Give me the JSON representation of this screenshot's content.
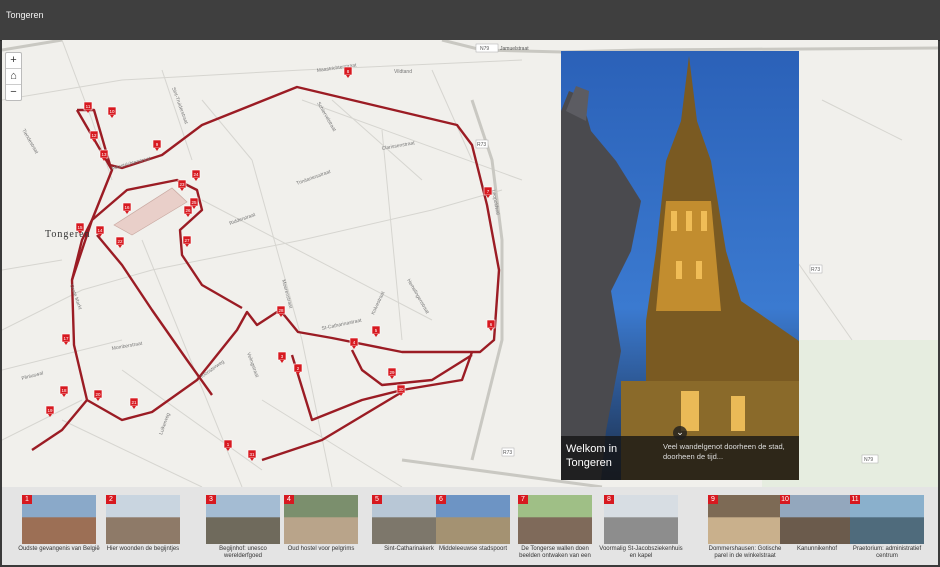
{
  "app": {
    "title": "Tongeren"
  },
  "map": {
    "city_label": "Tongeren",
    "zoom_in": "+",
    "home": "⌂",
    "zoom_out": "−",
    "streets": [
      "Maastrichterstraat",
      "Vildtand",
      "Sint-Jamuelstraat",
      "Clarissenstraat",
      "Trinitariersstraat",
      "Leopoldwal",
      "Ridderstraat",
      "Kolvestraat",
      "Schiervelstraat",
      "Hasseltsesteenweg",
      "Moerenstraat",
      "Tiendestraat",
      "Veemarkt",
      "Grote Markt",
      "Maastrichterstraat",
      "Pliniuswal",
      "Heilige-Geeststraat",
      "Hemelingenstraat",
      "Luikerweg",
      "Velingstraat",
      "Kloosterweg",
      "Sint-Truiderstraat",
      "Bilzersteenweg",
      "Koninksemsteenweg"
    ],
    "road_codes": [
      "N79",
      "R73",
      "R73",
      "R73",
      "N79"
    ],
    "route_color": "#9b1c24",
    "marker_color": "#d71920",
    "markers": [
      "1",
      "2",
      "3",
      "4",
      "5",
      "6",
      "7",
      "8",
      "9",
      "10",
      "11",
      "12",
      "13",
      "14",
      "15",
      "16",
      "17",
      "18",
      "19",
      "20",
      "21",
      "22",
      "23",
      "24",
      "25",
      "26",
      "27",
      "28",
      "29",
      "30",
      "31"
    ]
  },
  "photo": {
    "title": "Welkom in Tongeren",
    "description": "Veel wandelgenot doorheen de stad, doorheen de tijd...",
    "chevron": "⌄"
  },
  "strip": {
    "items": [
      {
        "num": "1",
        "label": "Oudste gevangenis van België"
      },
      {
        "num": "2",
        "label": "Hier woonden de begijntjes"
      },
      {
        "num": "3",
        "label": "Begijnhof: unesco werelderfgoed"
      },
      {
        "num": "4",
        "label": "Oud hostel voor pelgrims"
      },
      {
        "num": "5",
        "label": "Sint-Catharinakerk"
      },
      {
        "num": "6",
        "label": "Middeleeuwse stadspoort"
      },
      {
        "num": "7",
        "label": "De Tongerse wallen doen beelden ontwaken van een"
      },
      {
        "num": "8",
        "label": "Voormalig St-Jacobsziekenhuis en kapel"
      },
      {
        "num": "9",
        "label": "Dommershausen: Gotische parel in de winkelstraat"
      },
      {
        "num": "10",
        "label": "Kanunnikenhof"
      },
      {
        "num": "11",
        "label": "Praetorium: administratief centrum"
      }
    ]
  }
}
